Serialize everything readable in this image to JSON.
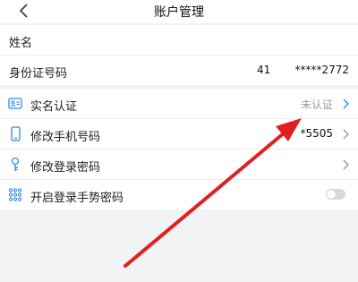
{
  "header": {
    "title": "账户管理",
    "back_icon": "chevron-left-icon"
  },
  "profile": {
    "name_label": "姓名",
    "id_label": "身份证号码",
    "id_prefix": "41",
    "id_suffix": "*****2772"
  },
  "settings": {
    "realname": {
      "label": "实名认证",
      "status": "未认证",
      "icon": "id-card-icon"
    },
    "phone": {
      "label": "修改手机号码",
      "value": "*5505",
      "icon": "phone-icon"
    },
    "password": {
      "label": "修改登录密码",
      "icon": "key-icon"
    },
    "gesture": {
      "label": "开启登录手势密码",
      "icon": "gesture-grid-icon",
      "enabled": false
    }
  },
  "annotation": {
    "color": "#e02020"
  }
}
